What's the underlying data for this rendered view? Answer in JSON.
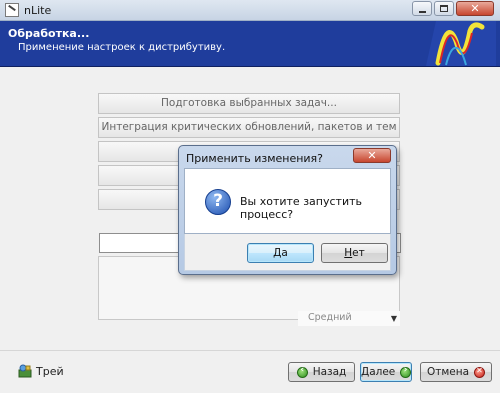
{
  "window": {
    "title": "nLite"
  },
  "header": {
    "title": "Обработка...",
    "subtitle": "Применение настроек к дистрибутиву."
  },
  "tasks": {
    "items": [
      "Подготовка выбранных задач...",
      "Интеграция критических обновлений, пакетов и тем",
      "",
      "",
      ""
    ],
    "progress": 0,
    "priority": "Средний"
  },
  "dialog": {
    "title": "Применить изменения?",
    "message": "Вы хотите запустить процесс?",
    "yes_first": "Д",
    "yes_rest": "а",
    "no_first": "Н",
    "no_rest": "ет"
  },
  "footer": {
    "tray_label": "Трей",
    "back_label": "Назад",
    "next_label": "Далее",
    "cancel_label": "Отмена"
  },
  "icons": {
    "app": "nlite-app-icon",
    "logo": "nlite-logo",
    "question": "question-icon",
    "tray": "tray-icon",
    "back": "back-arrow-icon",
    "next": "next-arrow-icon",
    "cancel": "cancel-icon"
  },
  "colors": {
    "header_bg": "#1f3d9c",
    "dialog_frame": "#b5c9e4",
    "close_red": "#c7462f"
  }
}
